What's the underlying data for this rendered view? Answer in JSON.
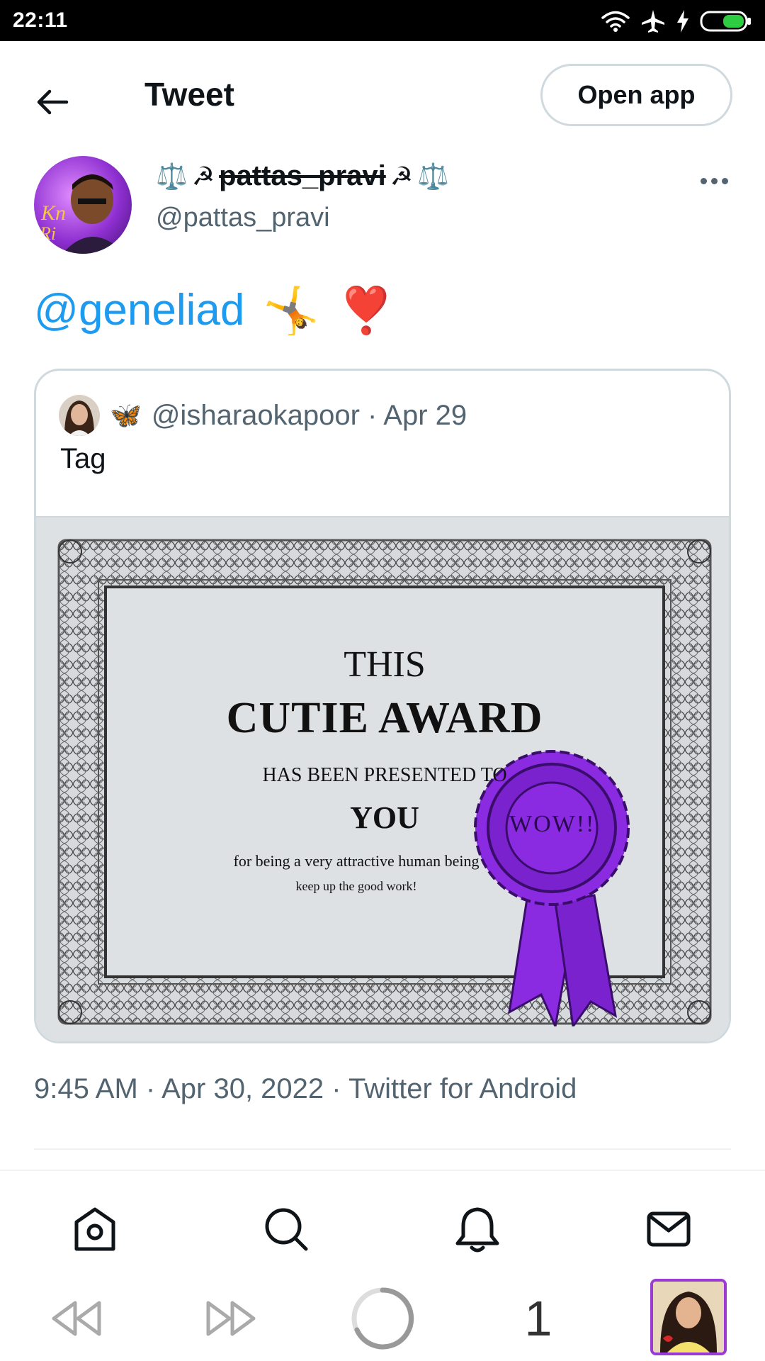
{
  "status_bar": {
    "time": "22:11",
    "icons": [
      "wifi-icon",
      "airplane-icon",
      "charging-icon",
      "battery-icon"
    ],
    "battery_color": "#2ecc40"
  },
  "header": {
    "back_icon": "arrow-left-icon",
    "title": "Tweet",
    "open_app_label": "Open app"
  },
  "tweet": {
    "author": {
      "display_name_prefix": "⚖️",
      "display_name_decor": "☭",
      "display_name": "pattas_pravi",
      "display_name_suffix": "⚖️",
      "handle": "@pattas_pravi"
    },
    "text_mention": "@geneliad",
    "text_emojis": [
      "🤸",
      "❣️"
    ],
    "quoted": {
      "badge_emoji": "🦋",
      "handle_and_date": "@isharaokapoor · Apr 29",
      "text": "Tag",
      "certificate": {
        "line1": "THIS",
        "line2": "CUTIE AWARD",
        "line3": "HAS BEEN PRESENTED TO",
        "line4": "YOU",
        "line5": "for being a very attractive human being",
        "line6": "keep up the good work!",
        "rosette_text": "WOW!!",
        "rosette_color": "#8a2be2"
      }
    },
    "meta": "9:45 AM · Apr 30, 2022 · Twitter for Android"
  },
  "bottom_nav": {
    "items": [
      "home-icon",
      "search-icon",
      "notifications-icon",
      "messages-icon"
    ]
  },
  "browser_bar": {
    "items": [
      "back-icon",
      "forward-icon",
      "loading-icon"
    ],
    "tab_count": "1"
  },
  "colors": {
    "link": "#1d9bf0",
    "secondary_text": "#536471",
    "border": "#cfd9de"
  }
}
